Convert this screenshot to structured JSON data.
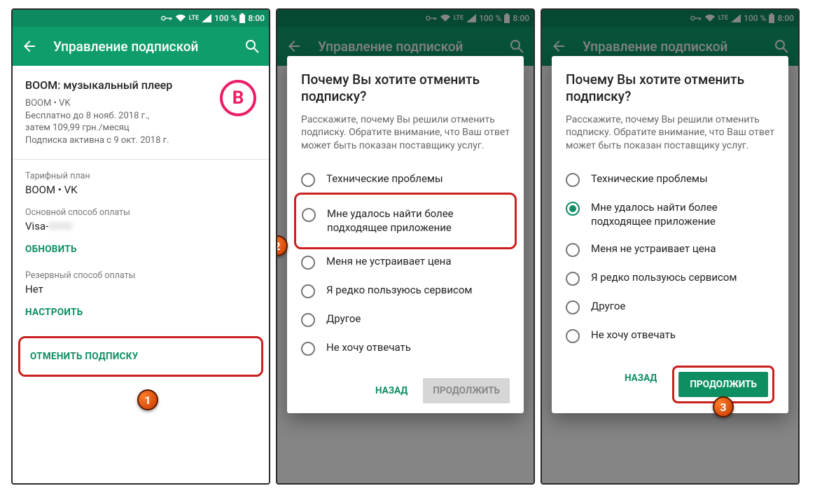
{
  "status": {
    "vpn": "⊶",
    "wifi": "wifi",
    "lte": "LTE",
    "signal": "◢",
    "battery": "100 %",
    "time": "8:00",
    "battery_icon": "▮"
  },
  "appbar": {
    "title": "Управление подпиской"
  },
  "screen1": {
    "app_title": "BOOM: музыкальный плеер",
    "line1": "BOOM • VK",
    "line2": "Бесплатно до 8 нояб. 2018 г.,",
    "line3": "затем 109,99 грн./месяц",
    "line4": "Подписка активна с 9 окт. 2018 г.",
    "app_icon_letter": "B",
    "plan_label": "Тарифный план",
    "plan_value": "BOOM • VK",
    "pay_label": "Основной способ оплаты",
    "pay_value_prefix": "Visa-",
    "pay_value_masked": "0000",
    "update_btn": "ОБНОВИТЬ",
    "backup_label": "Резервный способ оплаты",
    "backup_value": "Нет",
    "setup_btn": "НАСТРОИТЬ",
    "cancel_btn": "ОТМЕНИТЬ ПОДПИСКУ"
  },
  "dialog": {
    "title": "Почему Вы хотите отменить подписку?",
    "subtitle": "Расскажите, почему Вы решили отменить подписку. Обратите внимание, что Ваш ответ может быть показан поставщику услуг.",
    "options": [
      "Технические проблемы",
      "Мне удалось найти более подходящее приложение",
      "Меня не устраивает цена",
      "Я редко пользуюсь сервисом",
      "Другое",
      "Не хочу отвечать"
    ],
    "back": "НАЗАД",
    "continue": "ПРОДОЛЖИТЬ"
  },
  "markers": {
    "m1": "1",
    "m2": "2",
    "m3": "3"
  }
}
